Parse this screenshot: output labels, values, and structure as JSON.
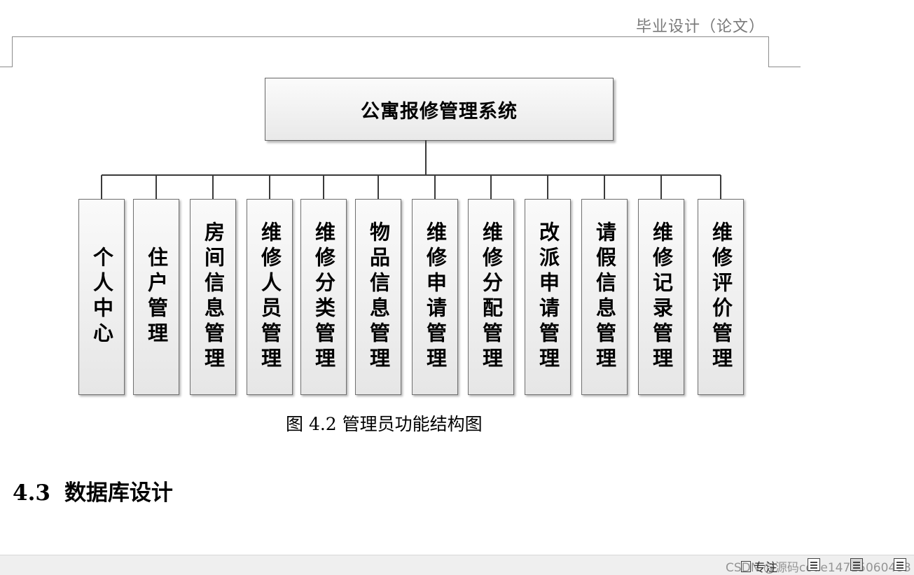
{
  "page_header": "毕业设计（论文）",
  "diagram": {
    "root": "公寓报修管理系统",
    "children": [
      "个人中心",
      "住户管理",
      "房间信息管理",
      "维修人员管理",
      "维修分类管理",
      "物品信息管理",
      "维修申请管理",
      "维修分配管理",
      "改派申请管理",
      "请假信息管理",
      "维修记录管理",
      "维修评价管理"
    ]
  },
  "caption": "图 4.2  管理员功能结构图",
  "section": {
    "number": "4.3",
    "title": "数据库设计"
  },
  "statusbar": {
    "watermark": "CSDN @源码code14715060483",
    "focus_label": "专注",
    "icons": [
      "focus-icon",
      "read-mode-icon",
      "print-layout-icon",
      "web-layout-icon"
    ]
  }
}
